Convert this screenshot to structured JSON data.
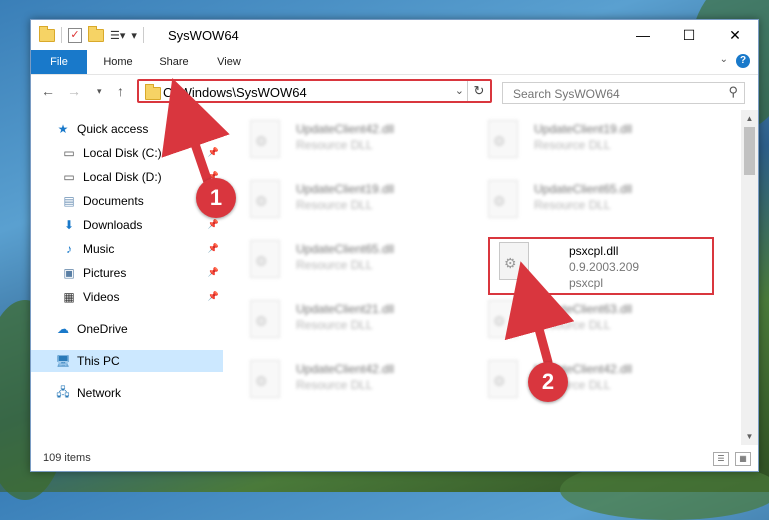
{
  "window": {
    "title": "SysWOW64",
    "minimize": "—",
    "maximize": "☐",
    "close": "✕"
  },
  "ribbon": {
    "tabs": [
      {
        "label": "File"
      },
      {
        "label": "Home"
      },
      {
        "label": "Share"
      },
      {
        "label": "View"
      }
    ],
    "help": "?"
  },
  "address": {
    "path": "C:\\Windows\\SysWOW64",
    "search_placeholder": "Search SysWOW64"
  },
  "nav": {
    "items": [
      {
        "label": "Quick access",
        "icon": "star-icon",
        "pinned": false
      },
      {
        "label": "Local Disk (C:)",
        "icon": "drive-icon",
        "pinned": true
      },
      {
        "label": "Local Disk (D:)",
        "icon": "drive-icon",
        "pinned": true
      },
      {
        "label": "Documents",
        "icon": "documents-icon",
        "pinned": true
      },
      {
        "label": "Downloads",
        "icon": "downloads-icon",
        "pinned": true
      },
      {
        "label": "Music",
        "icon": "music-icon",
        "pinned": true
      },
      {
        "label": "Pictures",
        "icon": "pictures-icon",
        "pinned": true
      },
      {
        "label": "Videos",
        "icon": "videos-icon",
        "pinned": true
      },
      {
        "label": "OneDrive",
        "icon": "cloud-icon",
        "pinned": false
      },
      {
        "label": "This PC",
        "icon": "computer-icon",
        "pinned": false
      },
      {
        "label": "Network",
        "icon": "network-icon",
        "pinned": false
      }
    ]
  },
  "files": [
    {
      "name": "UpdateClient42.dll",
      "line2": "Resource DLL",
      "line3": ""
    },
    {
      "name": "UpdateClient19.dll",
      "line2": "Resource DLL",
      "line3": ""
    },
    {
      "name": "UpdateClient19.dll",
      "line2": "Resource DLL",
      "line3": ""
    },
    {
      "name": "UpdateClient65.dll",
      "line2": "Resource DLL",
      "line3": ""
    },
    {
      "name": "UpdateClient65.dll",
      "line2": "Resource DLL",
      "line3": ""
    },
    {
      "name": "psxcpl.dll",
      "line2": "0.9.2003.209",
      "line3": "psxcpl"
    },
    {
      "name": "UpdateClient21.dll",
      "line2": "Resource DLL",
      "line3": ""
    },
    {
      "name": "UpdateClient63.dll",
      "line2": "Resource DLL",
      "line3": ""
    },
    {
      "name": "UpdateClient42.dll",
      "line2": "Resource DLL",
      "line3": ""
    },
    {
      "name": "UpdateClient42.dll",
      "line2": "Resource DLL",
      "line3": ""
    }
  ],
  "status": {
    "item_count": "109 items"
  },
  "callouts": {
    "one": "1",
    "two": "2",
    "color": "#d9363e"
  }
}
